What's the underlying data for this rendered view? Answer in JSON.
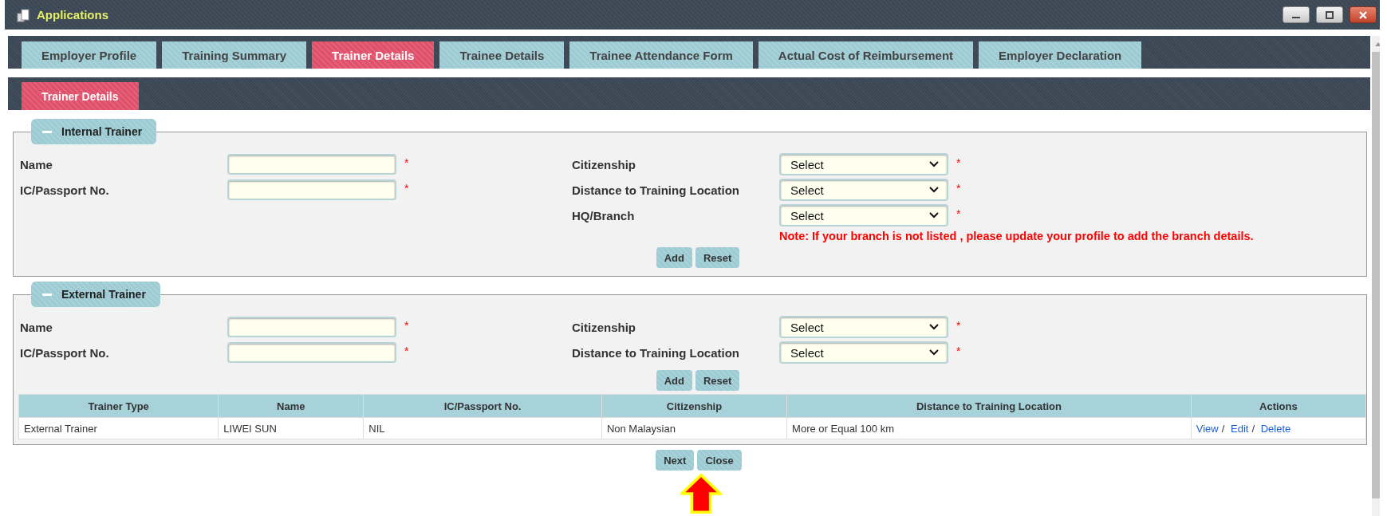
{
  "window": {
    "title": "Applications"
  },
  "tabs": [
    {
      "label": "Employer Profile",
      "selected": false
    },
    {
      "label": "Training Summary",
      "selected": false
    },
    {
      "label": "Trainer Details",
      "selected": true
    },
    {
      "label": "Trainee Details",
      "selected": false
    },
    {
      "label": "Trainee Attendance Form",
      "selected": false
    },
    {
      "label": "Actual Cost of Reimbursement",
      "selected": false
    },
    {
      "label": "Employer Declaration",
      "selected": false
    }
  ],
  "subtabs": [
    {
      "label": "Trainer Details",
      "selected": true
    }
  ],
  "sections": [
    {
      "title": "Internal Trainer",
      "expanded": true,
      "left_fields": [
        {
          "label": "Name",
          "required_mark": "*"
        },
        {
          "label": "IC/Passport No.",
          "required_mark": "*"
        }
      ],
      "right_fields": [
        {
          "label": "Citizenship",
          "value": "Select",
          "required_mark": "*"
        },
        {
          "label": "Distance to Training Location",
          "value": "Select",
          "required_mark": "*"
        },
        {
          "label": "HQ/Branch",
          "value": "Select",
          "required_mark": "*"
        }
      ],
      "note": "Note: If your branch is not listed , please update your profile to add the branch details.",
      "buttons": [
        "Add",
        "Reset"
      ]
    },
    {
      "title": "External Trainer",
      "expanded": true,
      "left_fields": [
        {
          "label": "Name",
          "required_mark": "*"
        },
        {
          "label": "IC/Passport No.",
          "required_mark": "*"
        }
      ],
      "right_fields": [
        {
          "label": "Citizenship",
          "value": "Select",
          "required_mark": "*"
        },
        {
          "label": "Distance to Training Location",
          "value": "Select",
          "required_mark": "*"
        }
      ],
      "buttons": [
        "Add",
        "Reset"
      ],
      "table": {
        "columns": [
          "Trainer Type",
          "Name",
          "IC/Passport No.",
          "Citizenship",
          "Distance to Training Location",
          "Actions"
        ],
        "rows": [
          {
            "cells": [
              "External Trainer",
              "LIWEI SUN",
              "NIL",
              "Non Malaysian",
              "More or Equal 100 km"
            ],
            "actions": [
              "View",
              "Edit",
              "Delete"
            ]
          }
        ],
        "action_separator": "/"
      }
    }
  ],
  "buttons": [
    "Next",
    "Close"
  ]
}
